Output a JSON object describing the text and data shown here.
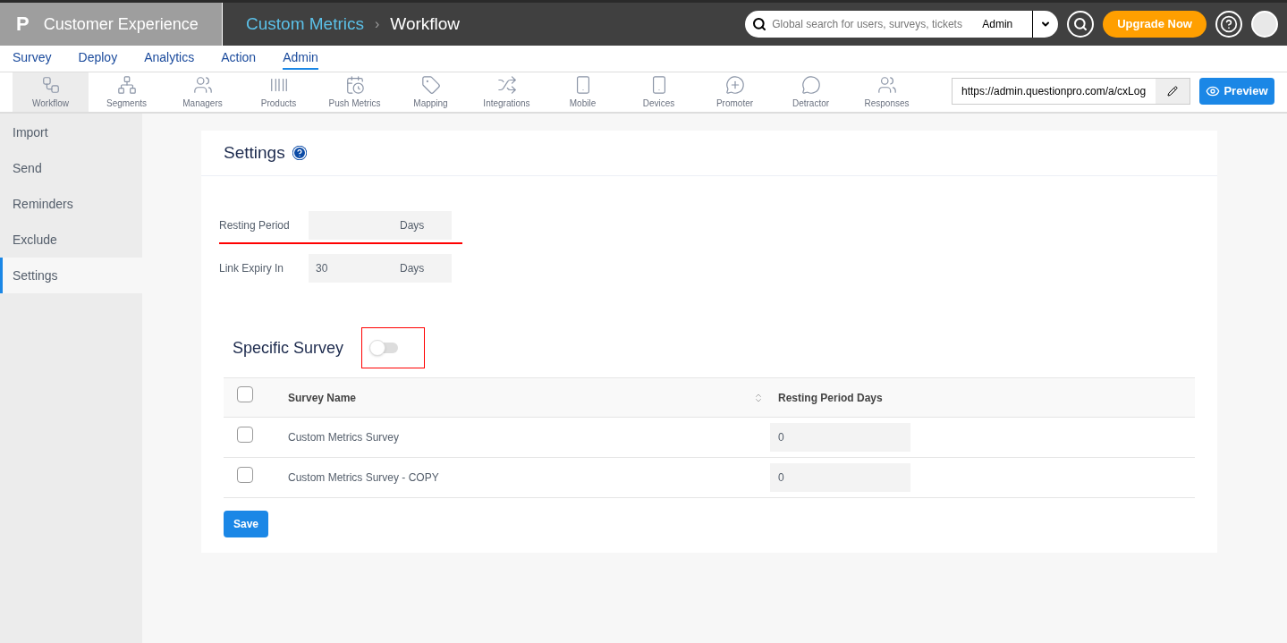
{
  "product": {
    "logo": "P",
    "name": "Customer Experience"
  },
  "breadcrumb": [
    "Custom Metrics",
    "›",
    "Workflow"
  ],
  "search": {
    "placeholder": "Global search for users, surveys, tickets",
    "scope": "Admin"
  },
  "upgrade_button": "Upgrade Now",
  "nav": [
    {
      "label": "Survey",
      "selected": false
    },
    {
      "label": "Deploy",
      "selected": false
    },
    {
      "label": "Analytics",
      "selected": false
    },
    {
      "label": "Action",
      "selected": false
    },
    {
      "label": "Admin",
      "selected": true
    }
  ],
  "toolbar": [
    {
      "kind": "workflow",
      "label": "Workflow",
      "selected": true
    },
    {
      "kind": "segments",
      "label": "Segments",
      "selected": false
    },
    {
      "kind": "managers",
      "label": "Managers",
      "selected": false
    },
    {
      "kind": "products",
      "label": "Products",
      "selected": false
    },
    {
      "kind": "push",
      "label": "Push Metrics",
      "selected": false
    },
    {
      "kind": "mapping",
      "label": "Mapping",
      "selected": false
    },
    {
      "kind": "integrations",
      "label": "Integrations",
      "selected": false
    },
    {
      "kind": "mobile",
      "label": "Mobile",
      "selected": false
    },
    {
      "kind": "devices",
      "label": "Devices",
      "selected": false
    },
    {
      "kind": "promoter",
      "label": "Promoter",
      "selected": false
    },
    {
      "kind": "detractor",
      "label": "Detractor",
      "selected": false
    },
    {
      "kind": "responses",
      "label": "Responses",
      "selected": false
    }
  ],
  "url_field": {
    "value": "https://admin.questionpro.com/a/cxLog"
  },
  "preview_button": "Preview",
  "sidebar": [
    {
      "label": "Import",
      "selected": false
    },
    {
      "label": "Send",
      "selected": false
    },
    {
      "label": "Reminders",
      "selected": false
    },
    {
      "label": "Exclude",
      "selected": false
    },
    {
      "label": "Settings",
      "selected": true
    }
  ],
  "page_title": "Settings",
  "fields": [
    {
      "label": "Resting Period",
      "unit": "Days",
      "highlighted": true
    },
    {
      "label": "Link Expiry In",
      "value": "30",
      "unit": "Days",
      "highlighted": false
    }
  ],
  "specific_survey": {
    "label": "Specific Survey",
    "on": false,
    "highlighted": true
  },
  "table": {
    "columns": [
      "Survey Name",
      "Resting Period Days"
    ],
    "select_all": false,
    "rows": [
      {
        "checked": false,
        "name": "Custom Metrics Survey",
        "days": "0"
      },
      {
        "checked": false,
        "name": "Custom Metrics Survey - COPY",
        "days": "0"
      }
    ]
  },
  "save_button": "Save"
}
